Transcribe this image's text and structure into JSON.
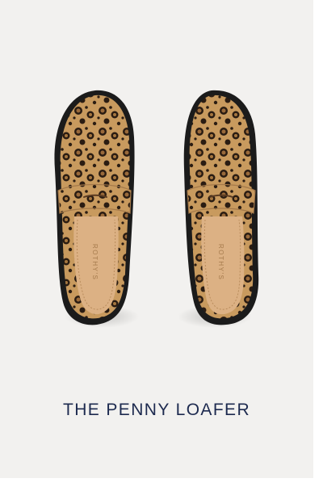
{
  "product": {
    "title": "THE PENNY LOAFER",
    "brand_stamp": "ROTHY'S"
  },
  "colors": {
    "background": "#f2f1ef",
    "title_text": "#1d2a4f",
    "knit_base": "#c89a5e",
    "spot_dark": "#2a1c12",
    "spot_center": "#9a6a3a",
    "sole": "#1b1b1b",
    "insole": "#dcb184"
  }
}
